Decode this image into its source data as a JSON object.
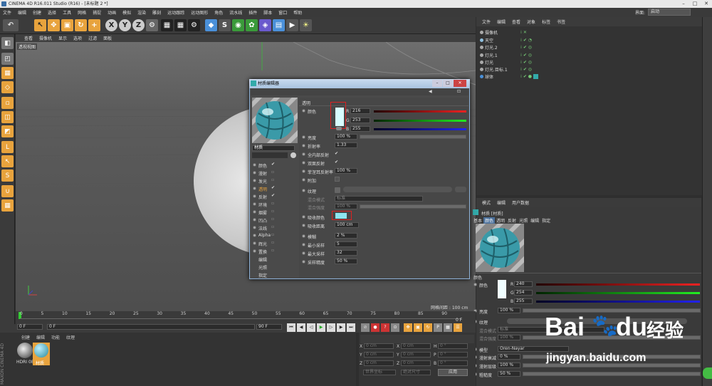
{
  "window": {
    "title": "CINEMA 4D R16.011 Studio (R16) - [未标题 2 *]",
    "controls": [
      "–",
      "□",
      "✕"
    ]
  },
  "menubar": [
    "文件",
    "编辑",
    "创建",
    "选择",
    "工具",
    "网格",
    "捕捉",
    "动画",
    "模拟",
    "渲染",
    "雕刻",
    "运动跟踪",
    "运动图形",
    "角色",
    "流水线",
    "插件",
    "脚本",
    "窗口",
    "帮助"
  ],
  "layout": {
    "label": "界面:",
    "value": "启动"
  },
  "viewport": {
    "menu": [
      "查看",
      "摄像机",
      "显示",
      "选项",
      "过滤",
      "面板"
    ],
    "label": "透视视图",
    "grid_info": "网格间距 : 100 cm"
  },
  "object_manager": {
    "menu": [
      "文件",
      "编辑",
      "查看",
      "对象",
      "标签",
      "书签"
    ],
    "objects": [
      {
        "name": "摄像机",
        "color": "#d9d9d9"
      },
      {
        "name": "天空",
        "color": "#8fc0e0"
      },
      {
        "name": "灯光.2",
        "color": "#d9d9d9"
      },
      {
        "name": "灯光.1",
        "color": "#d9d9d9"
      },
      {
        "name": "灯光",
        "color": "#d9d9d9"
      },
      {
        "name": "灯光.目标.1",
        "color": "#d9d9d9"
      },
      {
        "name": "球体",
        "color": "#d9d9d9"
      }
    ]
  },
  "material_editor": {
    "title": "材质编辑器",
    "material_name": "材质",
    "channels": [
      {
        "name": "颜色",
        "checked": true
      },
      {
        "name": "漫射",
        "checked": false
      },
      {
        "name": "发光",
        "checked": false
      },
      {
        "name": "透明",
        "checked": true,
        "active": true
      },
      {
        "name": "反射",
        "checked": true
      },
      {
        "name": "环境",
        "checked": false
      },
      {
        "name": "烟雾",
        "checked": false
      },
      {
        "name": "凹凸",
        "checked": false
      },
      {
        "name": "法线",
        "checked": false
      },
      {
        "name": "Alpha",
        "checked": false
      },
      {
        "name": "辉光",
        "checked": false
      },
      {
        "name": "置换",
        "checked": false
      },
      {
        "name": "编辑",
        "checked": null
      },
      {
        "name": "光照",
        "checked": null
      },
      {
        "name": "指定",
        "checked": null
      }
    ],
    "section": "透明",
    "color_label": "颜色",
    "rgb": {
      "r": "216",
      "g": "253",
      "b": "255"
    },
    "rgb_labels": {
      "r": "R",
      "g": "G",
      "b": "B"
    },
    "params": {
      "brightness": {
        "label": "亮度",
        "value": "100 %"
      },
      "refraction": {
        "label": "折射率",
        "value": "1.33"
      },
      "total_internal": {
        "label": "全内部反射",
        "value": "✔"
      },
      "double_sided": {
        "label": "双面反射",
        "value": "✔"
      },
      "fresnel": {
        "label": "菲涅耳反射率",
        "value": "100 %"
      },
      "additive": {
        "label": "附加",
        "value": ""
      },
      "texture": {
        "label": "纹理",
        "value": ""
      },
      "mix_mode": {
        "label": "混合模式",
        "value": "标准"
      },
      "mix_strength": {
        "label": "混合强度",
        "value": "100 %"
      },
      "absorption_color": {
        "label": "吸收颜色",
        "value": ""
      },
      "absorption_distance": {
        "label": "吸收距离",
        "value": "100 cm"
      },
      "blur": {
        "label": "模糊",
        "value": "2 %"
      },
      "min_samples": {
        "label": "最小采样",
        "value": "5"
      },
      "max_samples": {
        "label": "最大采样",
        "value": "32"
      },
      "accuracy": {
        "label": "采样精度",
        "value": "50 %"
      }
    }
  },
  "attributes": {
    "menu": [
      "模式",
      "编辑",
      "用户数据"
    ],
    "material_title": "材质 [材质]",
    "tabs": [
      "基本",
      "颜色",
      "透明",
      "反射",
      "光照",
      "编辑",
      "指定"
    ],
    "section": "颜色",
    "color_label": "颜色",
    "rgb": {
      "r": "240",
      "g": "254",
      "b": "255"
    },
    "rgb_labels": {
      "r": "R",
      "g": "G",
      "b": "B"
    },
    "brightness": {
      "label": "亮度",
      "value": "100 %"
    },
    "texture": {
      "label": "纹理",
      "value": ""
    },
    "mix_mode": {
      "label": "混合模式",
      "value": "标准"
    },
    "mix_strength": {
      "label": "混合强度",
      "value": "100 %"
    },
    "model": {
      "label": "模型",
      "value": "Oren-Nayar"
    },
    "diffuse_falloff": {
      "label": "漫射衰减",
      "value": "0 %"
    },
    "diffuse_level": {
      "label": "漫射层级",
      "value": "100 %"
    },
    "roughness": {
      "label": "粗糙度",
      "value": "50 %"
    }
  },
  "timeline": {
    "ticks": [
      "0",
      "5",
      "10",
      "15",
      "20",
      "25",
      "30",
      "35",
      "40",
      "45",
      "50",
      "55",
      "60",
      "65",
      "70",
      "75",
      "80",
      "85",
      "90"
    ],
    "end_frame": "0 F",
    "current": "0 F",
    "start": "0 F",
    "max": "90 F",
    "max2": "90 F"
  },
  "material_manager": {
    "menu": [
      "创建",
      "编辑",
      "功能",
      "纹理"
    ],
    "materials": [
      {
        "name": "HDRI 08"
      },
      {
        "name": "材质"
      }
    ],
    "brand": "MAXON CINEMA 4D"
  },
  "coords": {
    "rows": [
      {
        "a": "X",
        "av": "0 cm",
        "b": "X",
        "bv": "0 cm",
        "c": "H",
        "cv": "0 °"
      },
      {
        "a": "Y",
        "av": "0 cm",
        "b": "Y",
        "bv": "0 cm",
        "c": "P",
        "cv": "0 °"
      },
      {
        "a": "Z",
        "av": "0 cm",
        "b": "Z",
        "bv": "0 cm",
        "c": "B",
        "cv": "0 °"
      }
    ],
    "space": "世界坐标",
    "scale": "绝对尺寸",
    "apply": "应用"
  },
  "watermark": {
    "brand": "Bai",
    "paw": "🐾",
    "du": "du",
    "jingyan": "经验",
    "url": "jingyan.baidu.com"
  },
  "colors": {
    "accent_orange": "#e8a33d",
    "dialog_border": "#8fb3d9",
    "swatch": "#d8fdff",
    "attr_swatch": "#f0feff"
  }
}
